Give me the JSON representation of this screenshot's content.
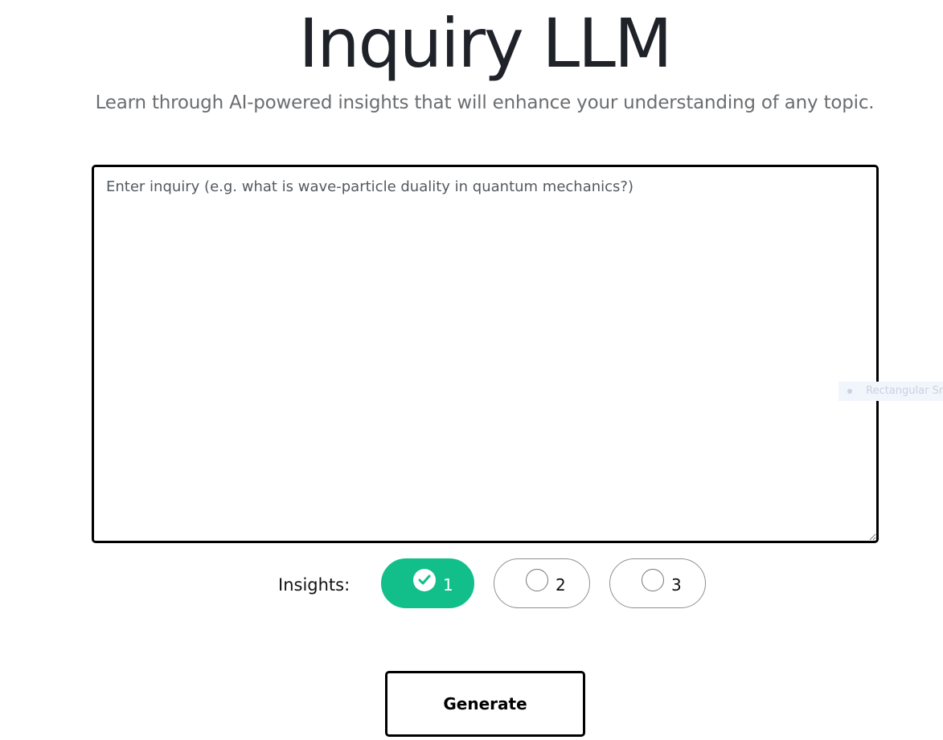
{
  "header": {
    "title": "Inquiry LLM",
    "subtitle": "Learn through AI-powered insights that will enhance your understanding of any topic."
  },
  "inquiry": {
    "placeholder": "Enter inquiry (e.g. what is wave-particle duality in quantum mechanics?)",
    "value": ""
  },
  "overlay": {
    "partial_label": "Rectangular Sn"
  },
  "insights": {
    "label": "Insights:",
    "selected": "1",
    "options": [
      {
        "label": "1",
        "selected": true,
        "icon": "check-icon"
      },
      {
        "label": "2",
        "selected": false,
        "icon": "empty-radio-icon"
      },
      {
        "label": "3",
        "selected": false,
        "icon": "empty-radio-icon"
      }
    ]
  },
  "actions": {
    "generate_label": "Generate"
  },
  "colors": {
    "selected_option": "#12bf8a",
    "text_primary": "#1f2329",
    "text_muted": "#6b6d70",
    "border": "#000000"
  }
}
